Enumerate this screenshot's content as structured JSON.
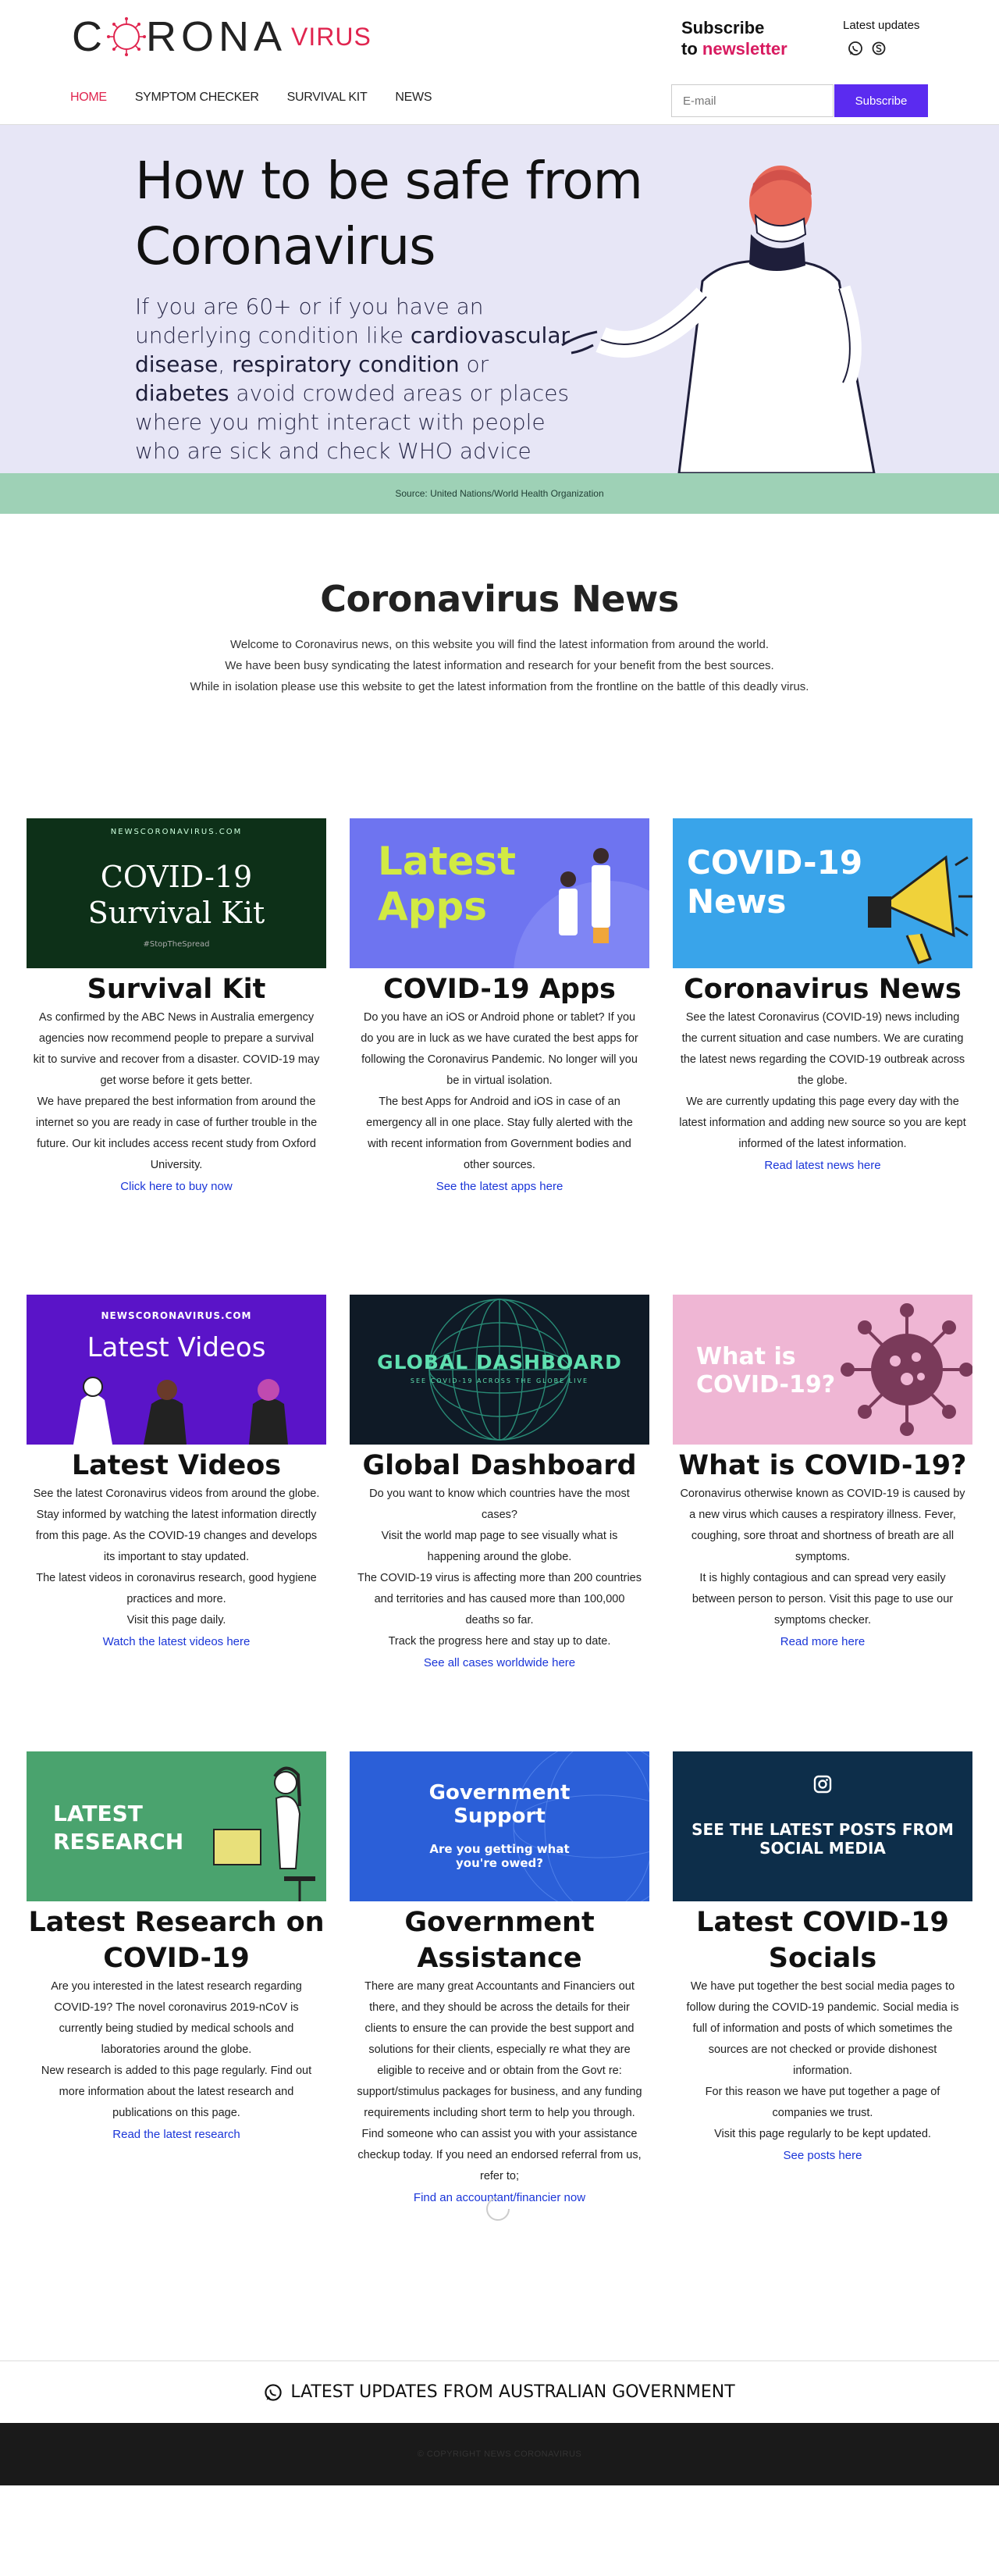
{
  "header": {
    "logo_text": "CORONA",
    "logo_virus": "VIRUS",
    "subscribe_line1": "Subscribe",
    "subscribe_to": "to",
    "subscribe_newsletter": "newsletter",
    "latest_updates": "Latest updates",
    "email_placeholder": "E-mail",
    "subscribe_button": "Subscribe",
    "nav": [
      "HOME",
      "SYMPTOM CHECKER",
      "SURVIVAL KIT",
      "NEWS"
    ],
    "icons": [
      "whatsapp-icon",
      "skype-icon"
    ]
  },
  "hero": {
    "title": "How to be safe from Coronavirus",
    "text_a": "If you are 60+ or if you have an underlying condition like ",
    "bold_1": "cardiovascular disease",
    "text_b": ", ",
    "bold_2": "respiratory condition",
    "text_c": " or ",
    "bold_3": "diabetes",
    "text_d": " avoid crowded areas or places where you might interact with people who are sick and check WHO advice",
    "source": "Source: United Nations/World Health Organization"
  },
  "intro": {
    "title": "Coronavirus News",
    "line1": "Welcome to Coronavirus news, on this website you will find the latest information from around the world.",
    "line2": "We have been busy syndicating the latest information and research for your benefit from the best sources.",
    "line3": "While in isolation please use this website to get the latest information from the frontline on the battle of this deadly virus."
  },
  "cards": [
    {
      "img_top": "NEWSCORONAVIRUS.COM",
      "img_title1": "COVID-19",
      "img_title2": "Survival Kit",
      "img_tag": "#StopTheSpread",
      "title": "Survival Kit",
      "p1": "As confirmed by the ABC News in Australia emergency agencies now recommend people to prepare a survival kit to survive and recover from a disaster. COVID-19 may get worse before it gets better.",
      "p2": "We have prepared the best information from around the internet so you are ready in case of further trouble in the future. Our kit includes access recent study from Oxford University.",
      "link": "Click here to buy now"
    },
    {
      "img_title1": "Latest",
      "img_title2": "Apps",
      "title": "COVID-19 Apps",
      "p1": "Do you have an iOS or Android phone or tablet? If you do you are in luck as we have curated the best apps for following the Coronavirus Pandemic. No longer will you be in virtual isolation.",
      "p2": "The best Apps for Android and iOS in case of an emergency all in one place. Stay fully alerted with the with recent information from Government bodies and other sources.",
      "link": "See the latest apps here"
    },
    {
      "img_title1": "COVID-19",
      "img_title2": "News",
      "title": "Coronavirus News",
      "p1": "See the latest Coronavirus (COVID-19) news including the current situation and case numbers. We are curating the latest news regarding the COVID-19 outbreak across the globe.",
      "p2": "We are currently updating this page every day with the latest information and adding new source so you are kept informed of the latest information.",
      "link": "Read latest news here"
    },
    {
      "img_top": "NEWSCORONAVIRUS.COM",
      "img_title1": "Latest Videos",
      "title": "Latest Videos",
      "p1": "See the latest Coronavirus videos from around the globe. Stay informed by watching the latest information directly from this page. As the COVID-19 changes and develops its important to stay updated.",
      "p2": "The latest videos in coronavirus research, good hygiene practices and more.",
      "p3": "Visit this page daily.",
      "link": "Watch the latest videos here"
    },
    {
      "img_title1": "GLOBAL DASHBOARD",
      "img_tag": "SEE COVID-19 ACROSS THE GLOBE LIVE",
      "title": "Global Dashboard",
      "p1": "Do you want to know which countries have the most cases?",
      "p2": "Visit the world map page to see visually what is happening around the globe.",
      "p3": "The COVID-19 virus is affecting more than 200 countries and territories and has caused more than 100,000 deaths so far.",
      "p4": "Track the progress here and stay up to date.",
      "link": "See all cases worldwide here"
    },
    {
      "img_title1": "What is",
      "img_title2": "COVID-19?",
      "title": "What is COVID-19?",
      "p1": "Coronavirus otherwise known as COVID-19 is caused by a new virus which causes a respiratory illness. Fever, coughing, sore throat and shortness of breath are all symptoms.",
      "p2": "It is highly contagious and can spread very easily between person to person. Visit this page to use our symptoms checker.",
      "link": "Read more here"
    },
    {
      "img_title1": "LATEST",
      "img_title2": "RESEARCH",
      "title": "Latest Research on COVID-19",
      "p1": "Are you interested in the latest research regarding COVID-19? The novel coronavirus 2019-nCoV is currently being studied by medical schools and laboratories around the globe.",
      "p2": "New research is added to this page regularly. Find out more information about the latest research and publications on this page.",
      "link": "Read the latest research"
    },
    {
      "img_title1": "Government",
      "img_title2": "Support",
      "img_tag": "Are you getting what you're owed?",
      "title": "Government Assistance",
      "p1": "There are many great Accountants and Financiers out there, and they should be across the details for their clients to ensure the can provide the best support and solutions for their clients, especially re what they are eligible to receive and or obtain from the Govt re: support/stimulus packages for business, and any funding requirements including short term to help you through. Find someone who can assist you with your assistance checkup today. If you need an endorsed referral from us, refer to;",
      "link": "Find an accountant/financier now"
    },
    {
      "img_title1": "SEE THE LATEST POSTS FROM",
      "img_title2": "SOCIAL MEDIA",
      "title": "Latest COVID-19 Socials",
      "p1": "We have put together the best social media pages to follow during the COVID-19 pandemic. Social media is full of information and posts of which sometimes the sources are not checked or provide dishonest information.",
      "p2": "For this reason we have put together a page of companies we trust.",
      "p3": "Visit this page regularly to be kept updated.",
      "link": "See posts here"
    }
  ],
  "footer": {
    "updates": "LATEST UPDATES FROM AUSTRALIAN GOVERNMENT",
    "copyright": "© COPYRIGHT NEWS CORONAVIRUS"
  },
  "colors": {
    "accent_pink": "#e0254f",
    "button_purple": "#5b2bf0",
    "hero_bg": "#e7e6f6",
    "source_bar": "#9ed1b6",
    "link_blue": "#1a35d8"
  }
}
